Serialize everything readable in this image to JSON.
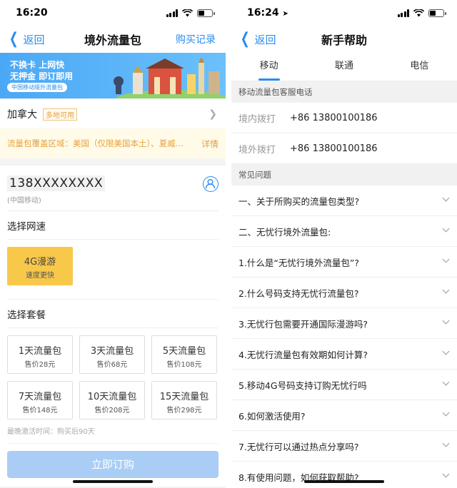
{
  "left": {
    "status": {
      "time": "16:20"
    },
    "nav": {
      "back": "返回",
      "title": "境外流量包",
      "right": "购买记录"
    },
    "banner": {
      "line1": "不换卡  上网快",
      "line2": "无押金  即订即用",
      "tag": "中国移动境外流量包"
    },
    "country": {
      "name": "加拿大",
      "badge": "多地可用"
    },
    "coverage": {
      "text": "流量包覆盖区域：美国（仅限美国本土）、夏威…",
      "detail": "详情"
    },
    "phone": {
      "number": "138XXXXXXXX",
      "carrier": "(中国移动)"
    },
    "speed_label": "选择网速",
    "speed": {
      "title": "4G漫游",
      "sub": "速度更快"
    },
    "package_label": "选择套餐",
    "packages": [
      {
        "name": "1天流量包",
        "price": "售价28元"
      },
      {
        "name": "3天流量包",
        "price": "售价68元"
      },
      {
        "name": "5天流量包",
        "price": "售价108元"
      },
      {
        "name": "7天流量包",
        "price": "售价148元"
      },
      {
        "name": "10天流量包",
        "price": "售价208元"
      },
      {
        "name": "15天流量包",
        "price": "售价298元"
      }
    ],
    "latest": "最晚激活时间：购买后90天",
    "order": "立即订购"
  },
  "right": {
    "status": {
      "time": "16:24"
    },
    "nav": {
      "back": "返回",
      "title": "新手帮助"
    },
    "tabs": [
      "移动",
      "联通",
      "电信"
    ],
    "service_head": "移动流量包客服电话",
    "service": [
      {
        "label": "境内拨打",
        "value": "+86 13800100186"
      },
      {
        "label": "境外拨打",
        "value": "+86 13800100186"
      }
    ],
    "faq_head": "常见问题",
    "faq": [
      "一、关于所购买的流量包类型?",
      "二、无忧行境外流量包:",
      "1.什么是“无忧行境外流量包”?",
      "2.什么号码支持无忧行流量包?",
      "3.无忧行包需要开通国际漫游吗?",
      "4.无忧行流量包有效期如何计算?",
      "5.移动4G号码支持订购无忧行吗",
      "6.如何激活使用?",
      "7.无忧行可以通过热点分享吗?",
      "8.有使用问题，如何获取帮助?"
    ]
  },
  "colors": {
    "accent": "#2a8cf0",
    "warning": "#e6a23c",
    "speed_bg": "#f7c84a",
    "order_disabled": "#a9cdf5"
  }
}
